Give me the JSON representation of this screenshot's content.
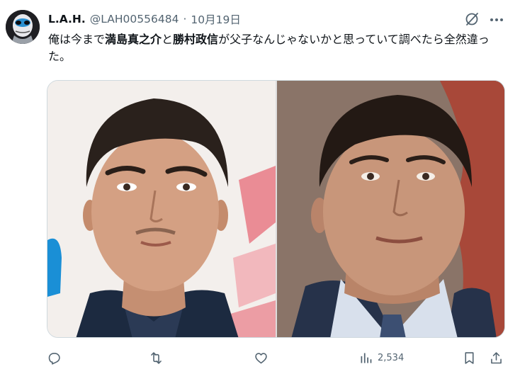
{
  "tweet": {
    "author_name": "L.A.H.",
    "handle": "@LAH00556484",
    "separator": "·",
    "date": "10月19日",
    "text_parts": [
      "俺は今まで",
      "満島真之介",
      "と",
      "勝村政信",
      "が父子なんじゃないかと思っていて調べたら全然違った。"
    ]
  },
  "actions": {
    "views_count": "2,534"
  },
  "icons": {
    "reply": "reply-icon",
    "retweet": "retweet-icon",
    "like": "heart-icon",
    "views": "views-chart-icon",
    "bookmark": "bookmark-icon",
    "share": "share-icon",
    "grok": "grok-icon",
    "more": "more-icon"
  },
  "colors": {
    "text": "#0f1419",
    "secondary": "#536471",
    "border": "#cfd9de"
  }
}
